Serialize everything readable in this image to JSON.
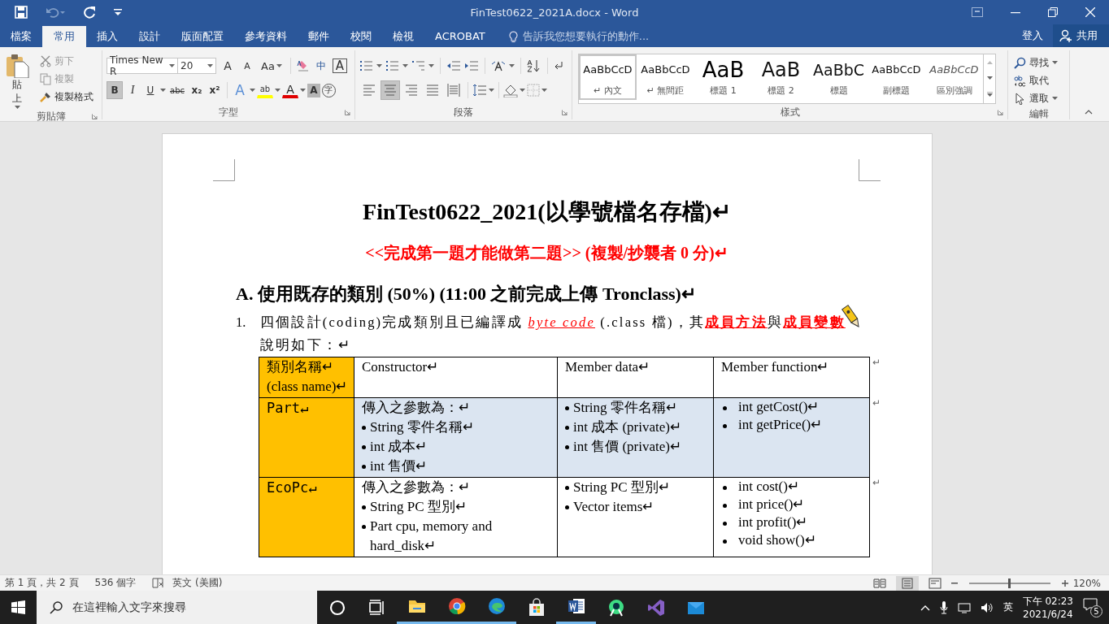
{
  "window": {
    "title": "FinTest0622_2021A.docx - Word"
  },
  "tabs": [
    {
      "label": "檔案",
      "selected": false
    },
    {
      "label": "常用",
      "selected": true
    },
    {
      "label": "插入",
      "selected": false
    },
    {
      "label": "設計",
      "selected": false
    },
    {
      "label": "版面配置",
      "selected": false
    },
    {
      "label": "參考資料",
      "selected": false
    },
    {
      "label": "郵件",
      "selected": false
    },
    {
      "label": "校閱",
      "selected": false
    },
    {
      "label": "檢視",
      "selected": false
    },
    {
      "label": "ACROBAT",
      "selected": false
    }
  ],
  "tell_me": {
    "placeholder": "告訴我您想要執行的動作..."
  },
  "account": {
    "sign_in": "登入",
    "share": "共用"
  },
  "clipboard": {
    "label": "剪貼簿",
    "paste": "貼上",
    "tools": [
      {
        "label": "剪下",
        "kind": "cut",
        "disabled": true
      },
      {
        "label": "複製",
        "kind": "copy",
        "disabled": true
      },
      {
        "label": "複製格式",
        "kind": "painter",
        "disabled": false
      }
    ]
  },
  "font": {
    "label": "字型",
    "name": "Times New R",
    "size": "20",
    "sizing": [
      {
        "label": "A",
        "kind": "grow"
      },
      {
        "label": "A",
        "kind": "shrink"
      },
      {
        "label": "Aa",
        "kind": "case"
      }
    ],
    "marks": [
      {
        "label": "中",
        "kind": "phonetic"
      },
      {
        "label": "A",
        "kind": "border"
      }
    ],
    "toggles": [
      {
        "label": "B",
        "kind": "bold",
        "selected": true
      },
      {
        "label": "I",
        "kind": "italic",
        "selected": false
      },
      {
        "label": "U",
        "kind": "underline",
        "selected": false
      },
      {
        "label": "abc",
        "kind": "strike",
        "selected": false
      },
      {
        "label": "x₂",
        "kind": "sub",
        "selected": false
      },
      {
        "label": "x²",
        "kind": "sup",
        "selected": false
      }
    ],
    "effects": [
      {
        "label": "A",
        "kind": "effects"
      },
      {
        "label": "ab",
        "kind": "highlight"
      },
      {
        "label": "A",
        "kind": "color"
      },
      {
        "label": "A",
        "kind": "shading"
      },
      {
        "label": "字",
        "kind": "enclose"
      }
    ]
  },
  "paragraph": {
    "label": "段落",
    "alignment": [
      {
        "kind": "left",
        "selected": false
      },
      {
        "kind": "center",
        "selected": true
      },
      {
        "kind": "right",
        "selected": false
      },
      {
        "kind": "justify",
        "selected": false
      },
      {
        "kind": "distributed",
        "selected": false
      }
    ]
  },
  "styles": {
    "label": "樣式",
    "items": [
      {
        "sample": "AaBbCcD",
        "name": "↵ 內文",
        "kind": "body",
        "selected": true
      },
      {
        "sample": "AaBbCcD",
        "name": "↵ 無間距",
        "kind": "body",
        "selected": false
      },
      {
        "sample": "AaB",
        "name": "標題 1",
        "kind": "h1",
        "selected": false
      },
      {
        "sample": "AaB",
        "name": "標題 2",
        "kind": "h2",
        "selected": false
      },
      {
        "sample": "AaBbC",
        "name": "標題",
        "kind": "title",
        "selected": false
      },
      {
        "sample": "AaBbCcD",
        "name": "副標題",
        "kind": "subtitle",
        "selected": false
      },
      {
        "sample": "AaBbCcD",
        "name": "區別強調",
        "kind": "emphasis",
        "selected": false
      }
    ]
  },
  "editing": {
    "label": "編輯",
    "items": [
      {
        "label": "尋找",
        "kind": "find"
      },
      {
        "label": "取代",
        "kind": "replace"
      },
      {
        "label": "選取",
        "kind": "select"
      }
    ]
  },
  "document": {
    "title": "FinTest0622_2021(以學號檔名存檔)↵",
    "notice": "<<完成第一題才能做第二題>> (複製/抄襲者 0 分)↵",
    "heading": "A. 使用既存的類別  (50%) (11:00 之前完成上傳 Tronclass)↵",
    "items": [
      {
        "number": "1.",
        "text": "四個設計(coding)完成類別且已編譯成 *byte code* (.class  檔)，其**成員方法**與**成員變數**說明如下：↵"
      }
    ],
    "table": {
      "columns": [
        {
          "lines": [
            "類別名稱↵",
            "(class name)↵"
          ]
        },
        {
          "lines": [
            "Constructor↵"
          ]
        },
        {
          "lines": [
            "Member data↵"
          ]
        },
        {
          "lines": [
            "Member function↵"
          ]
        }
      ],
      "end_mark": "↵",
      "rows": [
        {
          "class_name": "Part↵",
          "selected": true,
          "end_mark": "↵",
          "constructor_intro": "傳入之參數為：↵",
          "constructor_params": [
            "String  零件名稱↵",
            "int  成本↵",
            "int  售價↵"
          ],
          "member_data": [
            "String  零件名稱↵",
            "int  成本  (private)↵",
            "int  售價  (private)↵"
          ],
          "member_functions": [
            "int getCost()↵",
            "int getPrice()↵"
          ]
        },
        {
          "class_name": "EcoPc↵",
          "selected": false,
          "end_mark": "↵",
          "constructor_intro": "傳入之參數為：↵",
          "constructor_params": [
            "String PC 型別↵",
            "Part cpu, memory and hard_disk↵"
          ],
          "member_data": [
            "String PC 型別↵",
            "Vector items↵"
          ],
          "member_functions": [
            "int cost()↵",
            "int price()↵",
            "int profit()↵",
            "void show()↵"
          ]
        }
      ]
    }
  },
  "status_bar": {
    "page": "第 1 頁，共 2 頁",
    "words": "536 個字",
    "language": "英文 (美國)",
    "views": [
      {
        "kind": "read",
        "selected": false
      },
      {
        "kind": "print",
        "selected": true
      },
      {
        "kind": "web",
        "selected": false
      }
    ],
    "zoom": {
      "level": 0.5,
      "reading": "120%"
    }
  },
  "taskbar": {
    "search": {
      "placeholder": "在這裡輸入文字來搜尋"
    },
    "apps": [
      {
        "kind": "explorer",
        "running": true
      },
      {
        "kind": "chrome",
        "running": true
      },
      {
        "kind": "edge",
        "running": true
      },
      {
        "kind": "store",
        "running": false
      },
      {
        "kind": "word",
        "running": true
      },
      {
        "kind": "android",
        "running": false
      },
      {
        "kind": "vs",
        "running": false
      },
      {
        "kind": "mail",
        "running": false
      }
    ],
    "ime": "英",
    "time": "下午 02:23",
    "date": "2021/6/24",
    "notifications": "5"
  }
}
